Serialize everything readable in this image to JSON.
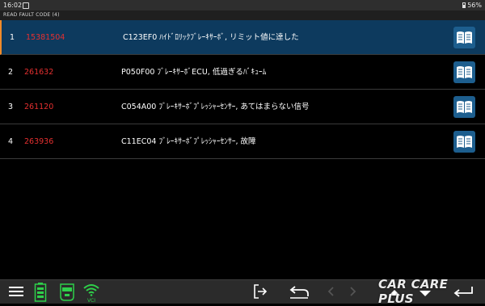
{
  "status_bar": {
    "time": "16:02",
    "battery": "56%"
  },
  "title": "READ FAULT CODE (4)",
  "faults": [
    {
      "index": "1",
      "code": "15381504",
      "description": "C123EF0 ﾊｲﾄﾞﾛﾘｯｸﾌﾞﾚｰｷｻｰﾎﾞ, リミット値に達した"
    },
    {
      "index": "2",
      "code": "261632",
      "description": "P050F00 ﾌﾞﾚｰｷｻｰﾎﾞECU, 低過ぎるﾊﾞｷｭｰﾑ"
    },
    {
      "index": "3",
      "code": "261120",
      "description": "C054A00 ﾌﾞﾚｰｷｻｰﾎﾞﾌﾟﾚｯｼｬｰｾﾝｻｰ, あてはまらない信号"
    },
    {
      "index": "4",
      "code": "263936",
      "description": "C11EC04 ﾌﾞﾚｰｷｻｰﾎﾞﾌﾟﾚｯｼｬｰｾﾝｻｰ, 故障"
    }
  ],
  "toolbar": {
    "vci_label": "VCI"
  },
  "watermark": "CAR CARE PLUS",
  "colors": {
    "selected_row": "#0d3a5e",
    "fault_code": "#e63030",
    "help_button": "#1d5e8e",
    "vci_green": "#2ed04a"
  }
}
